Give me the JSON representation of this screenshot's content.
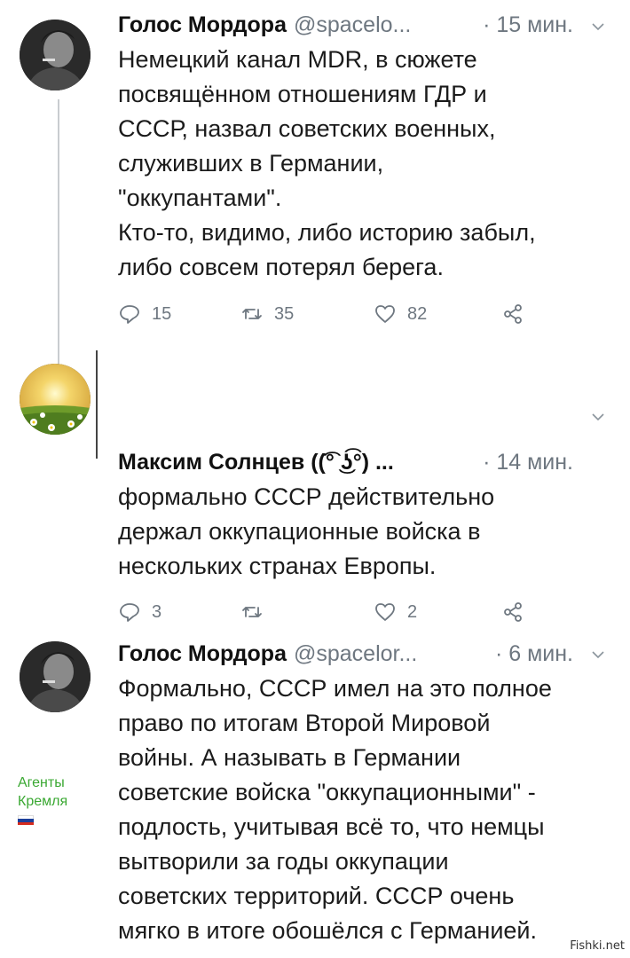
{
  "tweets": [
    {
      "name": "Голос Мордора",
      "handle": "@spacelo...",
      "time": "· 15 мин.",
      "text": "Немецкий канал MDR, в сюжете\nпосвящённом отношениям ГДР и\nСССР, назвал советских военных,\nслуживших в Германии,\n\"оккупантами\".\nКто-то, видимо, либо историю забыл,\nлибо совсем потерял берега.",
      "replies": "15",
      "retweets": "35",
      "likes": "82"
    },
    {
      "name": "Максим Солнцев ((͡° ͜ʖ͡°) ...",
      "time": "· 14 мин.",
      "text": "формально СССР действительно\nдержал оккупационные войска в\nнескольких странах Европы.",
      "replies": "3",
      "retweets": "",
      "likes": "2"
    },
    {
      "name": "Голос Мордора",
      "handle": "@spacelor...",
      "time": "· 6 мин.",
      "text": "Формально, СССР имел на это полное\nправо по итогам Второй Мировой\nвойны. А называть в Германии\nсоветские войска \"оккупационными\" -\nподлость, учитывая всё то, что немцы\nвытворили за годы оккупации\nсоветских территорий. СССР очень\nмягко в итоге обошёлся с Германией.",
      "badge": "Агенты\nКремля"
    }
  ],
  "watermark": "Fishki.net",
  "colors": {
    "secondary_text": "#6e7780",
    "badge_green": "#3aa832",
    "thread_line": "#c9ccd0"
  },
  "icons": [
    "reply-icon",
    "retweet-icon",
    "like-icon",
    "share-icon",
    "chevron-down-icon",
    "russia-flag-icon"
  ]
}
